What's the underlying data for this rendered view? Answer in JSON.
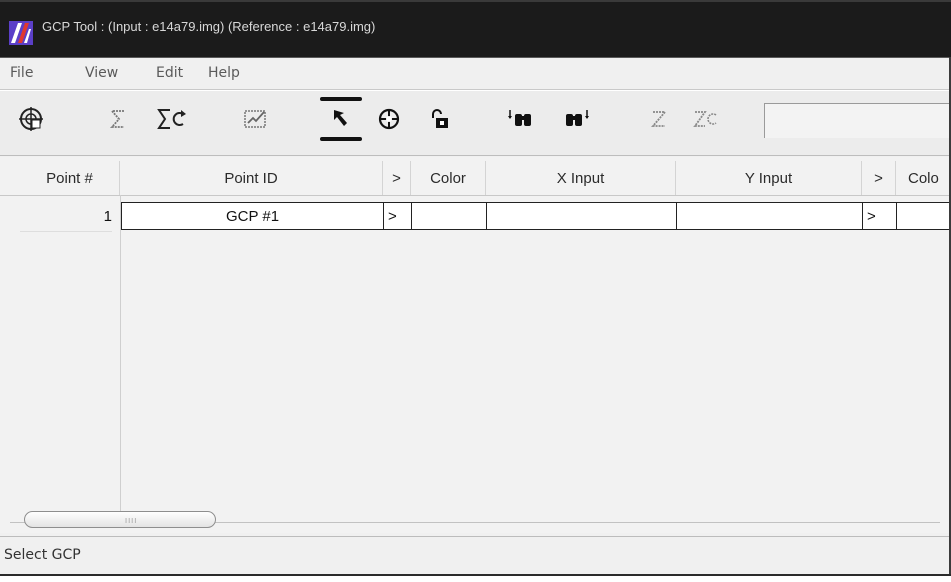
{
  "window": {
    "title": "GCP Tool : (Input : e14a79.img) (Reference : e14a79.img)"
  },
  "menu": {
    "items": [
      {
        "label": "File"
      },
      {
        "label": "View"
      },
      {
        "label": "Edit"
      },
      {
        "label": "Help"
      }
    ]
  },
  "toolbar": {
    "tools": [
      {
        "icon": "gcp-properties-icon",
        "active": false
      },
      {
        "icon": "sigma-icon",
        "active": false
      },
      {
        "icon": "sigma-refresh-icon",
        "active": false
      },
      {
        "icon": "chart-check-icon",
        "active": false
      },
      {
        "icon": "select-arrow-icon",
        "active": true
      },
      {
        "icon": "crosshair-icon",
        "active": false
      },
      {
        "icon": "lock-open-icon",
        "active": false
      },
      {
        "icon": "find-binoculars-up-icon",
        "active": false
      },
      {
        "icon": "find-binoculars-down-icon",
        "active": false
      },
      {
        "icon": "z-icon",
        "active": false
      },
      {
        "icon": "z-refresh-icon",
        "active": false
      }
    ]
  },
  "table": {
    "columns": [
      "Point #",
      "Point ID",
      ">",
      "Color",
      "X Input",
      "Y Input",
      ">",
      "Colo"
    ],
    "rows": [
      {
        "num": "1",
        "point_id": "GCP #1",
        "arrow1": ">",
        "color": "",
        "x_input": "",
        "y_input": "",
        "arrow2": ">",
        "color2": ""
      }
    ]
  },
  "scrollbar": {
    "grip": "IIII"
  },
  "status": {
    "text": "Select GCP"
  },
  "colors": {
    "titlebar": "#1b1b1b",
    "logo_purple": "#5b3fc8",
    "logo_red": "#e0382f",
    "active_tool_bar": "#111111"
  }
}
